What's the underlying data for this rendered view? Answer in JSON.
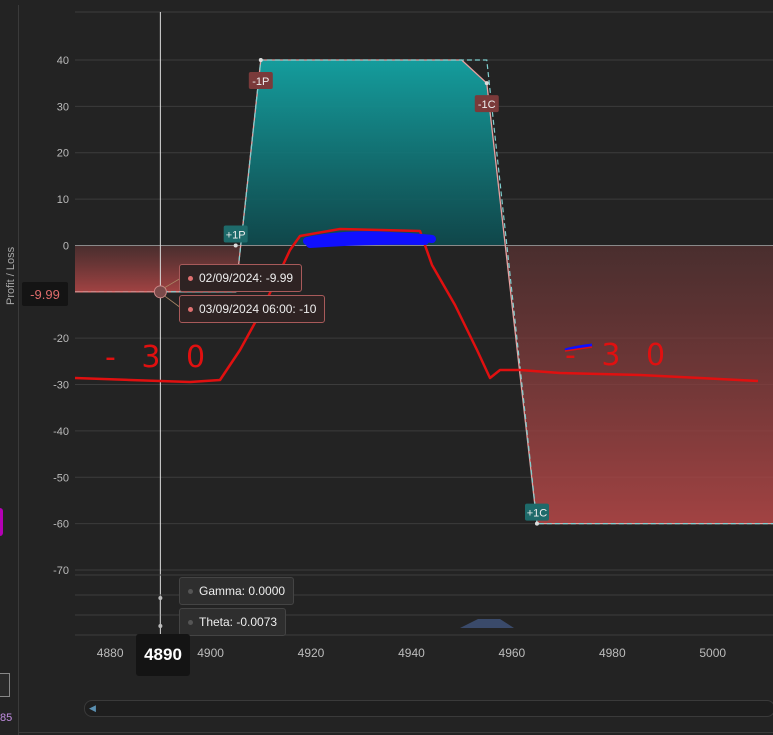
{
  "colors": {
    "profit_fill": "#1fa0a0",
    "loss_fill": "#e05a5a",
    "annotation_red": "#e01010",
    "annotation_blue": "#1010ff",
    "tooltip_border": "#a85a5a"
  },
  "chart_data": {
    "type": "area",
    "ylabel": "Profit / Loss",
    "ylim": [
      -70,
      40
    ],
    "yticks": [
      40,
      30,
      20,
      10,
      0,
      -20,
      -30,
      -40,
      -50,
      -60,
      -70
    ],
    "xlim": [
      4873,
      5012
    ],
    "xticks": [
      4880,
      4900,
      4920,
      4940,
      4960,
      4980,
      5000
    ],
    "grid": true,
    "series": [
      {
        "expiry": [
          {
            "x": 4873,
            "y": -10
          },
          {
            "x": 4905,
            "y": -10
          },
          {
            "x": 4910,
            "y": 40
          },
          {
            "x": 4950,
            "y": 40
          },
          {
            "x": 4955,
            "y": 35
          },
          {
            "x": 4965,
            "y": -60
          },
          {
            "x": 5012,
            "y": -60
          }
        ],
        "projection": [
          {
            "x": 4873,
            "y": -10
          },
          {
            "x": 4905,
            "y": -10
          },
          {
            "x": 4910,
            "y": 40
          },
          {
            "x": 4955,
            "y": 40
          },
          {
            "x": 4965,
            "y": -60
          },
          {
            "x": 5012,
            "y": -60
          }
        ]
      }
    ],
    "markers": [
      {
        "label": "-1P",
        "x": 4910,
        "y": 40
      },
      {
        "label": "-1C",
        "x": 4955,
        "y": 35
      },
      {
        "label": "+1P",
        "x": 4905,
        "y": 0
      },
      {
        "label": "+1C",
        "x": 4965,
        "y": -60
      }
    ],
    "cursor": {
      "x": 4890,
      "x_label": "4890",
      "y_label": "-9.99"
    },
    "tooltips": [
      "02/09/2024: -9.99",
      "03/09/2024 06:00: -10"
    ],
    "greeks": [
      {
        "label": "Gamma:",
        "value": "0.0000"
      },
      {
        "label": "Theta:",
        "value": "-0.0073"
      }
    ],
    "handwritten_annotations": [
      "- 3 0",
      "- 3 0"
    ]
  },
  "left_edge": {
    "partial_number": "85"
  }
}
